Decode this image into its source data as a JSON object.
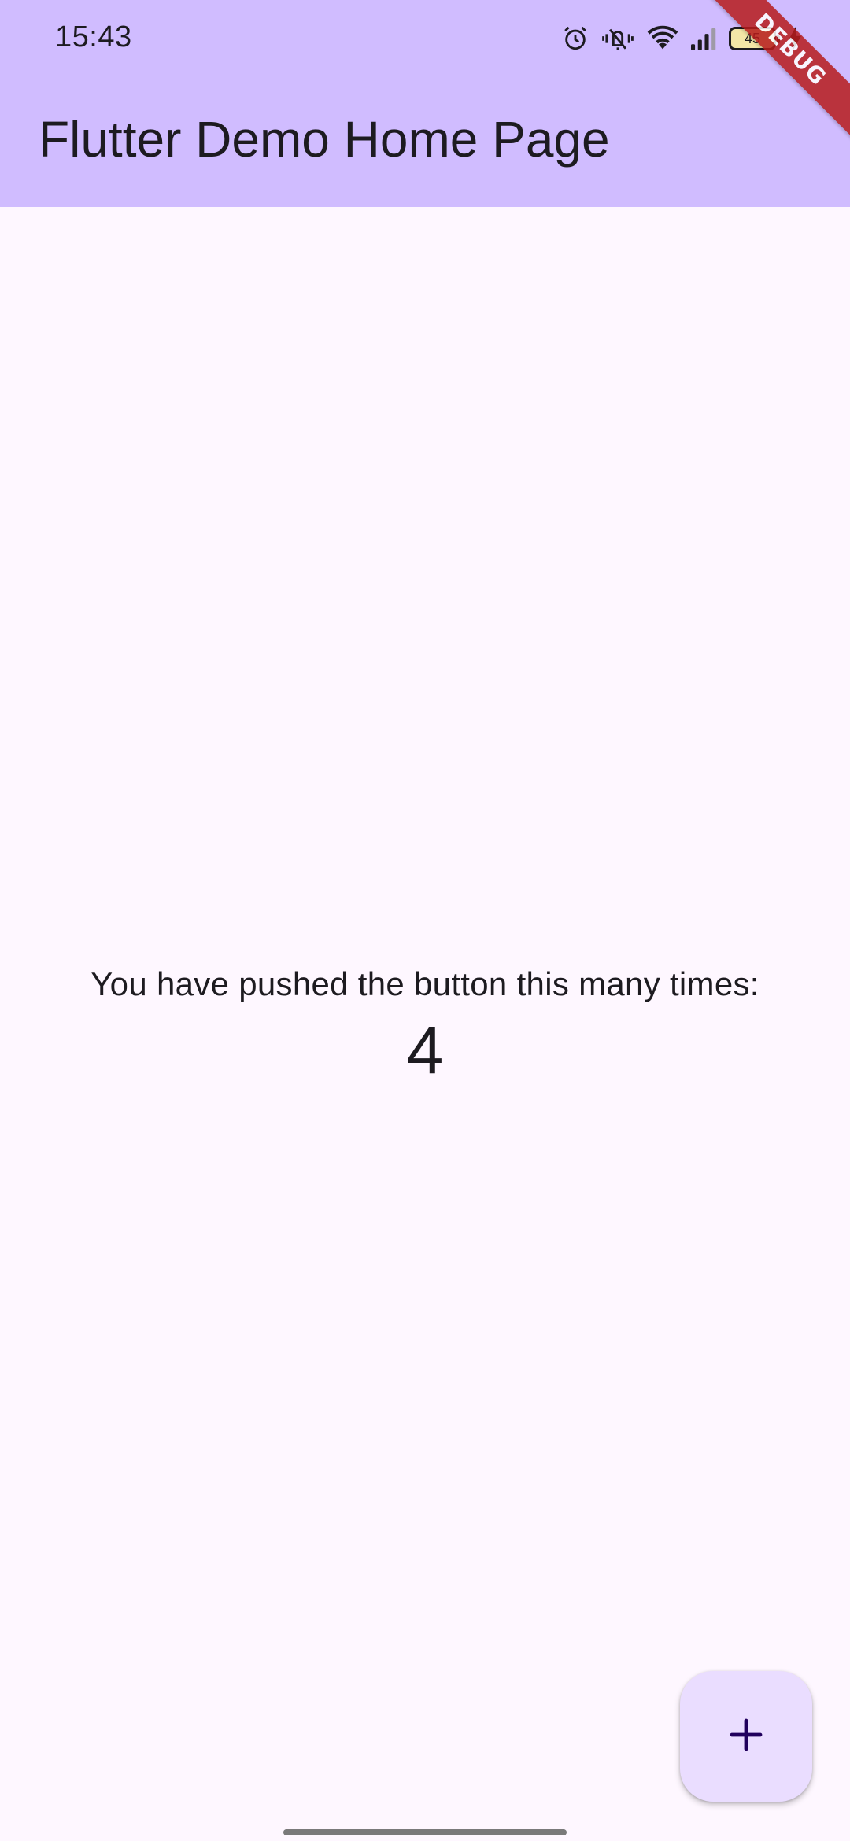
{
  "status_bar": {
    "time": "15:43",
    "battery_level": "45",
    "icons": [
      "alarm-icon",
      "vibrate-icon",
      "wifi-icon",
      "signal-icon",
      "battery-icon",
      "charging-icon"
    ]
  },
  "app_bar": {
    "title": "Flutter Demo Home Page",
    "color": "#d0bcff"
  },
  "debug_banner": {
    "label": "DEBUG",
    "color": "#b71c1c"
  },
  "body": {
    "message": "You have pushed the button this many times:",
    "counter": "4",
    "background": "#fef7ff"
  },
  "fab": {
    "icon": "plus-icon",
    "color": "#eaddff"
  }
}
